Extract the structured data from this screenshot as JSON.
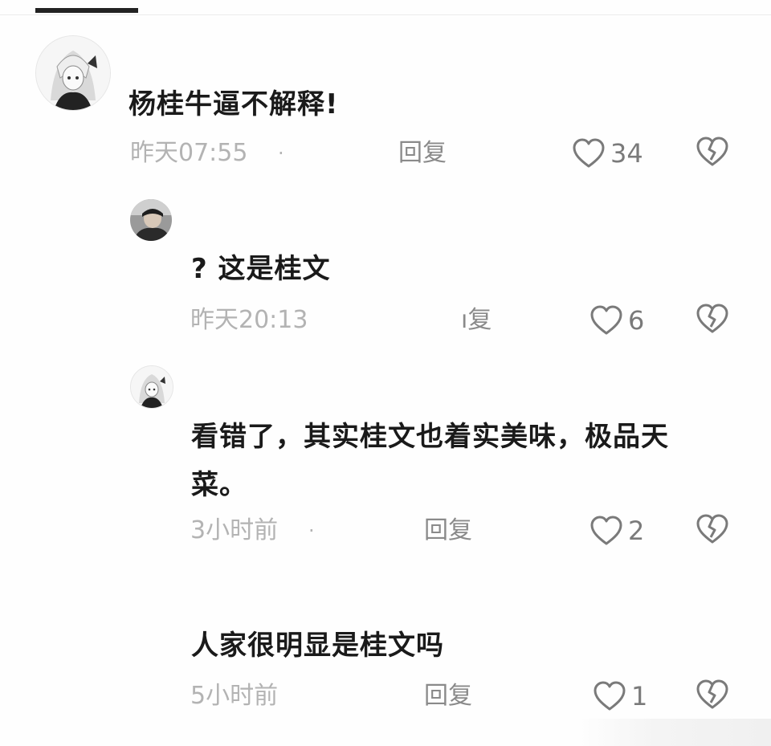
{
  "comments": [
    {
      "text": "杨桂牛逼不解释!",
      "time": "昨天07:55",
      "separator": "·",
      "reply_label": "回复",
      "likes": "34",
      "avatar": "anime-avatar-icon"
    },
    {
      "text": "? 这是桂文",
      "time": "昨天20:13",
      "reply_label": "ı复",
      "likes": "6",
      "avatar": "user-photo-avatar-icon"
    },
    {
      "text_line1": "看错了，其实桂文也着实美味，极品天",
      "text_line2": "菜。",
      "time": "3小时前",
      "separator": "·",
      "reply_label": "回复",
      "likes": "2",
      "avatar": "anime-avatar-icon"
    },
    {
      "text": "人家很明显是桂文吗",
      "time": "5小时前",
      "reply_label": "回复",
      "likes": "1"
    }
  ],
  "icons": {
    "like": "heart-outline-icon",
    "dislike": "broken-heart-icon"
  },
  "colors": {
    "text": "#1a1a1a",
    "meta": "#b3b3b3",
    "icon": "#7a7a7a"
  }
}
